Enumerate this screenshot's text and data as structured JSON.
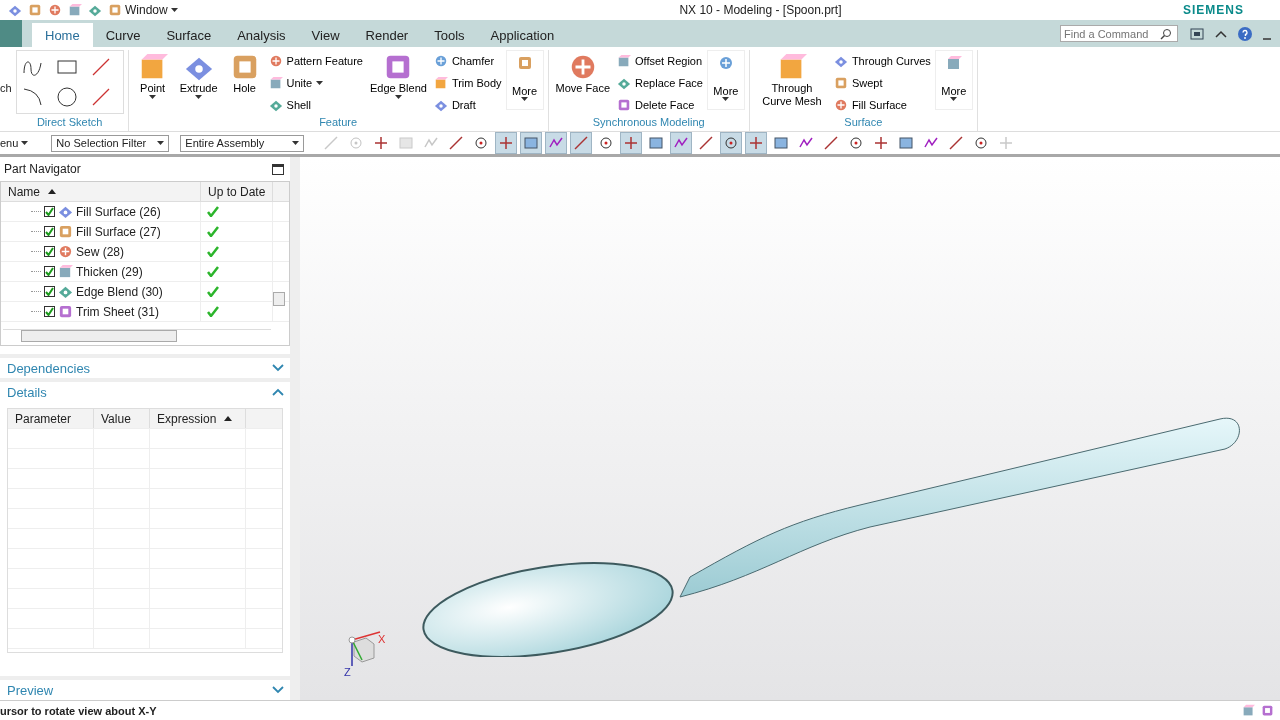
{
  "quick_access": {
    "window_menu": "Window"
  },
  "window": {
    "title": "NX 10 - Modeling - [Spoon.prt]",
    "brand": "SIEMENS"
  },
  "tabs": [
    {
      "label": "Home",
      "selected": true
    },
    {
      "label": "Curve",
      "selected": false
    },
    {
      "label": "Surface",
      "selected": false
    },
    {
      "label": "Analysis",
      "selected": false
    },
    {
      "label": "View",
      "selected": false
    },
    {
      "label": "Render",
      "selected": false
    },
    {
      "label": "Tools",
      "selected": false
    },
    {
      "label": "Application",
      "selected": false
    }
  ],
  "command_search": {
    "placeholder": "Find a Command"
  },
  "ribbon": {
    "cut_label": "ch",
    "groups": [
      {
        "label": "Direct Sketch",
        "items": [
          {
            "kind": "sketch"
          }
        ]
      },
      {
        "label": "Feature",
        "items": [
          {
            "kind": "large",
            "label": "Point",
            "dropdown": true
          },
          {
            "kind": "large",
            "label": "Extrude",
            "dropdown": true
          },
          {
            "kind": "large",
            "label": "Hole",
            "dropdown": false
          },
          {
            "kind": "stack",
            "entries": [
              {
                "label": "Pattern Feature",
                "dropdown": false
              },
              {
                "label": "Unite",
                "dropdown": true
              },
              {
                "label": "Shell",
                "dropdown": false
              }
            ]
          },
          {
            "kind": "large",
            "label": "Edge Blend",
            "dropdown": true
          },
          {
            "kind": "stack",
            "entries": [
              {
                "label": "Chamfer",
                "dropdown": false
              },
              {
                "label": "Trim Body",
                "dropdown": false
              },
              {
                "label": "Draft",
                "dropdown": false
              }
            ]
          },
          {
            "kind": "more",
            "label": "More"
          }
        ]
      },
      {
        "label": "Synchronous Modeling",
        "items": [
          {
            "kind": "large",
            "label": "Move Face",
            "dropdown": false
          },
          {
            "kind": "stack",
            "entries": [
              {
                "label": "Offset Region",
                "dropdown": false
              },
              {
                "label": "Replace Face",
                "dropdown": false
              },
              {
                "label": "Delete Face",
                "dropdown": false
              }
            ]
          },
          {
            "kind": "more",
            "label": "More"
          }
        ]
      },
      {
        "label": "Surface",
        "items": [
          {
            "kind": "large",
            "label": "Through Curve Mesh",
            "dropdown": false
          },
          {
            "kind": "stack",
            "entries": [
              {
                "label": "Through Curves",
                "dropdown": false
              },
              {
                "label": "Swept",
                "dropdown": false
              },
              {
                "label": "Fill Surface",
                "dropdown": false
              }
            ]
          },
          {
            "kind": "more",
            "label": "More"
          }
        ]
      }
    ]
  },
  "toolbar": {
    "menu": "enu",
    "filters": [
      {
        "value": "No Selection Filter"
      },
      {
        "value": "Entire Assembly"
      }
    ],
    "buttons": [
      {
        "pressed": false,
        "disabled": true
      },
      {
        "pressed": false,
        "disabled": true
      },
      {
        "pressed": false,
        "disabled": false
      },
      {
        "pressed": false,
        "disabled": true
      },
      {
        "pressed": false,
        "disabled": true
      },
      {
        "pressed": false,
        "disabled": false
      },
      {
        "pressed": false,
        "disabled": false
      },
      {
        "pressed": true,
        "disabled": false
      },
      {
        "pressed": true,
        "disabled": false
      },
      {
        "pressed": true,
        "disabled": false
      },
      {
        "pressed": true,
        "disabled": false
      },
      {
        "pressed": false,
        "disabled": false
      },
      {
        "pressed": true,
        "disabled": false
      },
      {
        "pressed": false,
        "disabled": false
      },
      {
        "pressed": true,
        "disabled": false
      },
      {
        "pressed": false,
        "disabled": false
      },
      {
        "pressed": true,
        "disabled": false
      },
      {
        "pressed": true,
        "disabled": false
      },
      {
        "pressed": false,
        "disabled": false
      },
      {
        "pressed": false,
        "disabled": false
      },
      {
        "pressed": false,
        "disabled": false
      },
      {
        "pressed": false,
        "disabled": false
      },
      {
        "pressed": false,
        "disabled": false
      },
      {
        "pressed": false,
        "disabled": false
      },
      {
        "pressed": false,
        "disabled": false
      },
      {
        "pressed": false,
        "disabled": false
      },
      {
        "pressed": false,
        "disabled": false
      },
      {
        "pressed": false,
        "disabled": true
      }
    ]
  },
  "part_navigator": {
    "title": "Part Navigator",
    "columns": [
      "Name",
      "Up to Date"
    ],
    "rows": [
      {
        "label": "Fill Surface (26)",
        "checked": true,
        "up_to_date": true
      },
      {
        "label": "Fill Surface (27)",
        "checked": true,
        "up_to_date": true
      },
      {
        "label": "Sew (28)",
        "checked": true,
        "up_to_date": true
      },
      {
        "label": "Thicken (29)",
        "checked": true,
        "up_to_date": true
      },
      {
        "label": "Edge Blend (30)",
        "checked": true,
        "up_to_date": true
      },
      {
        "label": "Trim Sheet (31)",
        "checked": true,
        "up_to_date": true
      }
    ]
  },
  "sections": [
    {
      "label": "Dependencies",
      "expanded": false
    },
    {
      "label": "Details",
      "expanded": true
    }
  ],
  "details": {
    "columns": [
      "Parameter",
      "Value",
      "Expression"
    ]
  },
  "preview": {
    "label": "Preview",
    "expanded": false
  },
  "triad": {
    "x_label": "X",
    "z_label": "Z"
  },
  "status_bar": {
    "message": "ursor to rotate view about X-Y"
  }
}
